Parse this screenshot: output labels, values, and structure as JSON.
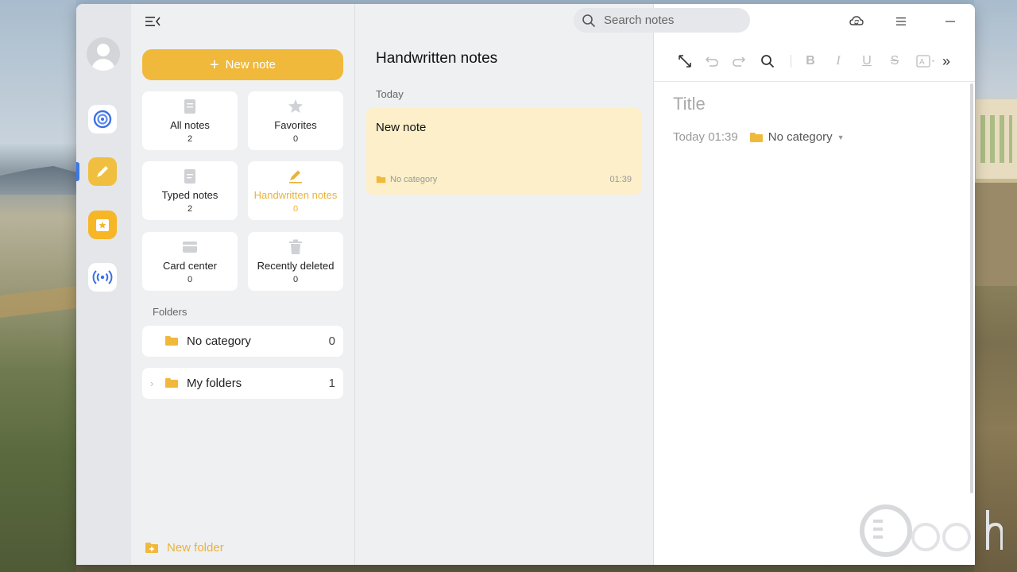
{
  "search": {
    "placeholder": "Search notes"
  },
  "sidebar": {
    "new_note_label": "New note",
    "tiles": [
      {
        "label": "All notes",
        "count": "2"
      },
      {
        "label": "Favorites",
        "count": "0"
      },
      {
        "label": "Typed notes",
        "count": "2"
      },
      {
        "label": "Handwritten notes",
        "count": "0"
      },
      {
        "label": "Card center",
        "count": "0"
      },
      {
        "label": "Recently deleted",
        "count": "0"
      }
    ],
    "folders_label": "Folders",
    "folders": [
      {
        "name": "No category",
        "count": "0"
      },
      {
        "name": "My folders",
        "count": "1"
      }
    ],
    "new_folder_label": "New folder"
  },
  "list": {
    "title": "Handwritten notes",
    "date_group": "Today",
    "notes": [
      {
        "title": "New note",
        "category": "No category",
        "time": "01:39"
      }
    ]
  },
  "editor": {
    "title_placeholder": "Title",
    "timestamp": "Today 01:39",
    "category": "No category"
  },
  "colors": {
    "accent": "#f0b93c",
    "note_bg": "#fcefc9",
    "active_text": "#eab23a"
  },
  "icons": [
    "menu-collapse-icon",
    "search-icon",
    "sync-icon",
    "more-menu-icon",
    "minimize-icon",
    "maximize-icon",
    "close-icon",
    "expand-icon",
    "undo-icon",
    "redo-icon",
    "bold-icon",
    "italic-icon",
    "underline-icon",
    "strikethrough-icon",
    "text-style-icon",
    "more-tools-icon",
    "folder-icon",
    "new-folder-icon"
  ]
}
